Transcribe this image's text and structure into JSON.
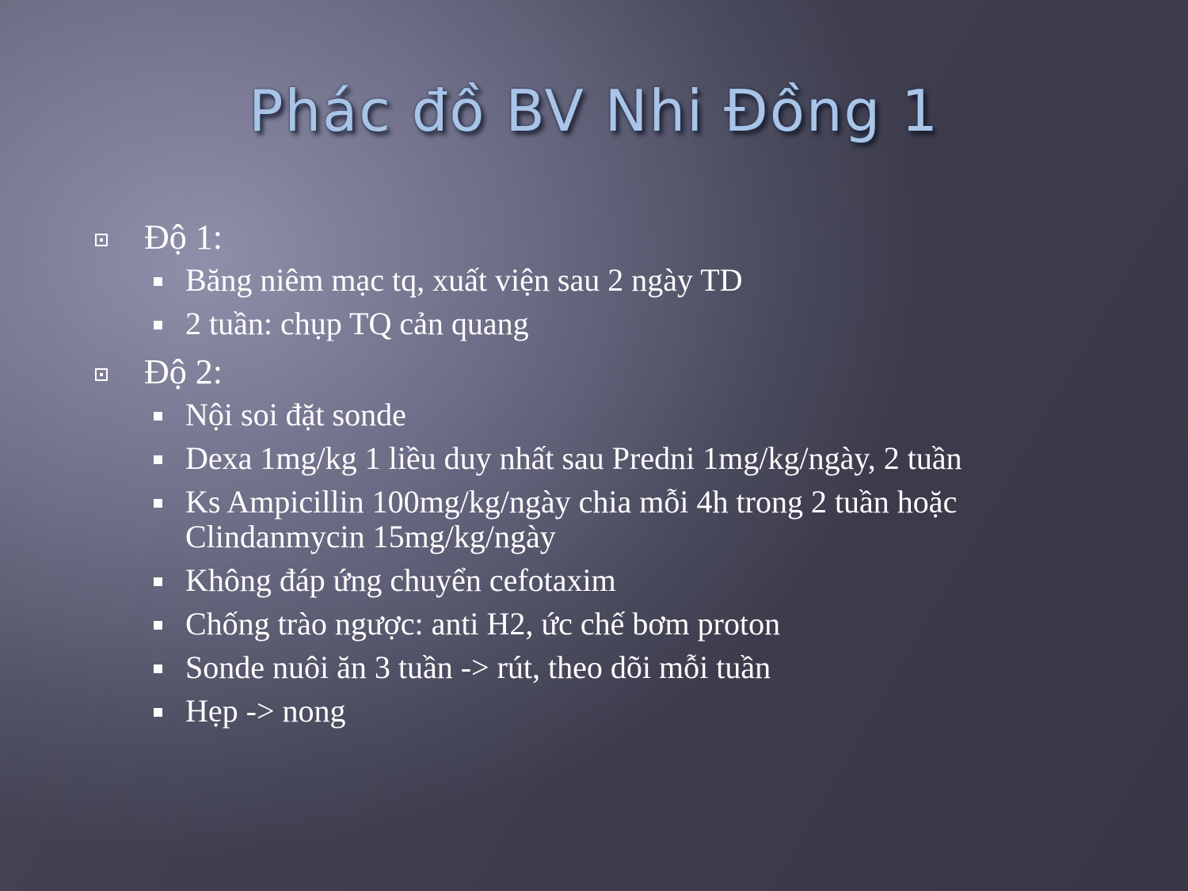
{
  "slide": {
    "title": "Phác đồ BV Nhi Đồng 1",
    "sections": [
      {
        "heading": "Độ 1:",
        "items": [
          "Băng niêm mạc tq, xuất viện sau 2 ngày TD",
          "2 tuần: chụp TQ cản quang"
        ]
      },
      {
        "heading": "Độ 2:",
        "items": [
          "Nội soi đặt sonde",
          "Dexa 1mg/kg  1 liều duy nhất  sau Predni 1mg/kg/ngày, 2 tuần",
          "Ks Ampicillin 100mg/kg/ngày chia mỗi 4h trong 2 tuần hoặc Clindanmycin 15mg/kg/ngày",
          "Không đáp ứng chuyển cefotaxim",
          "Chống trào ngược: anti H2, ức chế bơm proton",
          "Sonde nuôi ăn 3 tuần -> rút, theo dõi mỗi tuần",
          "Hẹp -> nong"
        ]
      }
    ]
  }
}
